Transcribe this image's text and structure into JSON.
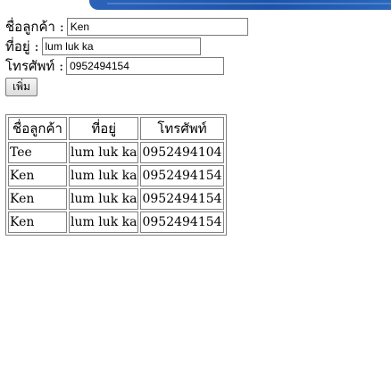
{
  "form": {
    "name_label": "ชื่อลูกค้า :",
    "name_value": "Ken",
    "address_label": "ที่อยู่ :",
    "address_value": "lum luk ka",
    "phone_label": "โทรศัพท์ :",
    "phone_value": "0952494154",
    "add_button_label": "เพิ่ม"
  },
  "table": {
    "headers": [
      "ชื่อลูกค้า",
      "ที่อยู่",
      "โทรศัพท์"
    ],
    "rows": [
      [
        "Tee",
        "lum luk ka",
        "0952494104"
      ],
      [
        "Ken",
        "lum luk ka",
        "0952494154"
      ],
      [
        "Ken",
        "lum luk ka",
        "0952494154"
      ],
      [
        "Ken",
        "lum luk ka",
        "0952494154"
      ]
    ]
  },
  "colors": {
    "top_band": "#1d54a8",
    "border": "#808080"
  }
}
